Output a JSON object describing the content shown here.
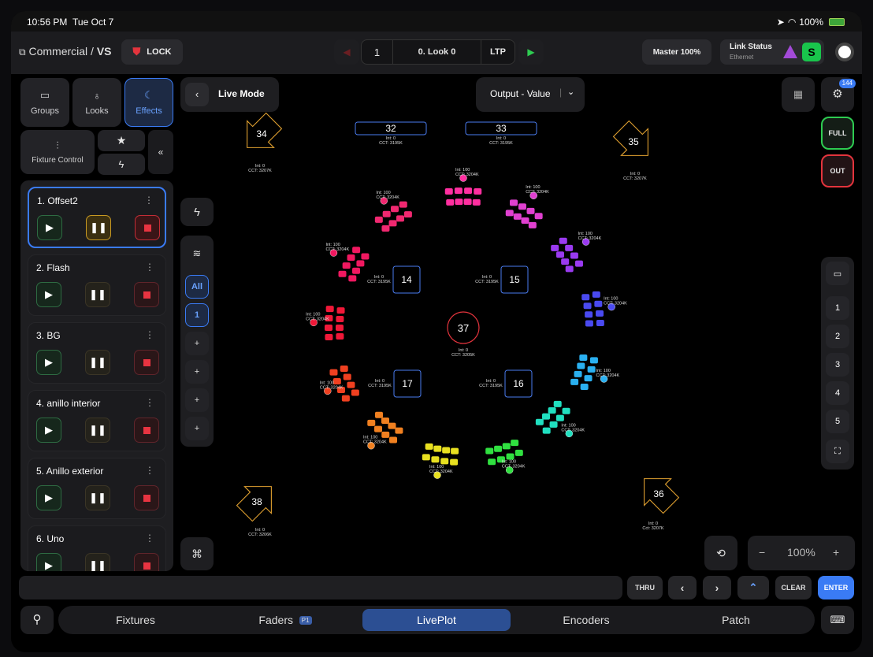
{
  "status_bar": {
    "time": "10:56 PM",
    "date": "Tue Oct 7",
    "battery": "100%"
  },
  "header": {
    "breadcrumb_parent": "Commercial",
    "breadcrumb_sep": " / ",
    "breadcrumb_current": "VS",
    "lock_label": "LOCK",
    "cue_number": "1",
    "cue_name": "0. Look 0",
    "mode": "LTP",
    "master": "Master 100%",
    "link_title": "Link Status",
    "link_sub": "Ethernet",
    "link_badge": "S"
  },
  "left_tabs": [
    {
      "label": "Groups",
      "icon": "folder-icon"
    },
    {
      "label": "Looks",
      "icon": "lightbulb-icon"
    },
    {
      "label": "Effects",
      "icon": "moon-icon"
    }
  ],
  "fixture_control_label": "Fixture Control",
  "effects": [
    {
      "name": "1. Offset2",
      "selected": true
    },
    {
      "name": "2. Flash"
    },
    {
      "name": "3. BG"
    },
    {
      "name": "4. anillo interior"
    },
    {
      "name": "5. Anillo exterior"
    },
    {
      "name": "6. Uno"
    }
  ],
  "live_mode_label": "Live Mode",
  "output_select": "Output - Value",
  "side_buttons": {
    "all": "All",
    "one": "1",
    "plus": "+"
  },
  "badge_count": "144",
  "right_buttons": {
    "full": "FULL",
    "out": "OUT",
    "presets": [
      "1",
      "2",
      "3",
      "4",
      "5"
    ]
  },
  "zoom": {
    "minus": "−",
    "value": "100%",
    "plus": "+"
  },
  "keys": {
    "thru": "THRU",
    "clear": "CLEAR",
    "enter": "ENTER"
  },
  "bottom_tabs": [
    {
      "label": "Fixtures"
    },
    {
      "label": "Faders",
      "badge": "P1"
    },
    {
      "label": "LivePlot",
      "active": true
    },
    {
      "label": "Encoders"
    },
    {
      "label": "Patch"
    }
  ],
  "plot": {
    "boxes": [
      {
        "id": "32",
        "int": "Int: 0",
        "cct": "CCT: 3195K"
      },
      {
        "id": "33",
        "int": "Int: 0",
        "cct": "CCT: 3195K"
      },
      {
        "id": "14",
        "int": "Int: 0",
        "cct": "CCT: 3195K"
      },
      {
        "id": "15",
        "int": "Int: 0",
        "cct": "CCT: 3195K"
      },
      {
        "id": "17",
        "int": "Int: 0",
        "cct": "CCT: 3195K"
      },
      {
        "id": "16",
        "int": "Int: 0",
        "cct": "CCT: 3195K"
      }
    ],
    "center": {
      "id": "37",
      "int": "Int: 0",
      "cct": "CCT: 3205K"
    },
    "arrows": [
      {
        "id": "34",
        "int": "Int: 0",
        "cct": "CCT: 3207K"
      },
      {
        "id": "35",
        "int": "Int: 0",
        "cct": "CCT: 3207K"
      },
      {
        "id": "38",
        "int": "Int: 0",
        "cct": "CCT: 3206K"
      },
      {
        "id": "36",
        "int": "Int: 0",
        "cct": "Cct: 3207K"
      }
    ],
    "ring_labels": [
      {
        "int": "Int: 100",
        "cct": "CCT: 3204K"
      }
    ]
  },
  "colors": {
    "accent": "#3a7bf5",
    "green": "#2ecc51",
    "red": "#e3343d",
    "orange": "#f0a020"
  }
}
